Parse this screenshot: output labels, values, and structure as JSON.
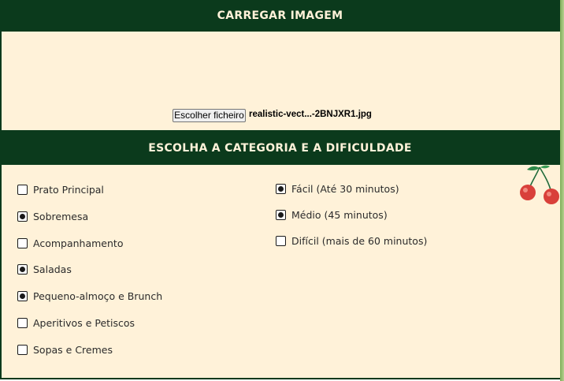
{
  "upload": {
    "title": "CARREGAR IMAGEM",
    "choose_label": "Escolher ficheiro",
    "file_name": "realistic-vect...-2BNJXR1.jpg"
  },
  "choose": {
    "title": "ESCOLHA A CATEGORIA E A DIFICULDADE"
  },
  "categories": [
    {
      "label": "Prato Principal",
      "checked": false
    },
    {
      "label": "Sobremesa",
      "checked": true
    },
    {
      "label": "Acompanhamento",
      "checked": false
    },
    {
      "label": "Saladas",
      "checked": true
    },
    {
      "label": "Pequeno-almoço e Brunch",
      "checked": true
    },
    {
      "label": "Aperitivos e Petiscos",
      "checked": false
    },
    {
      "label": "Sopas e Cremes",
      "checked": false
    }
  ],
  "difficulties": [
    {
      "label": "Fácil (Até 30 minutos)",
      "checked": true
    },
    {
      "label": "Médio (45 minutos)",
      "checked": true
    },
    {
      "label": "Difícil (mais de 60 minutos)",
      "checked": false
    }
  ],
  "colors": {
    "header_bg": "#0b3a1c",
    "panel_bg": "#fff2d9",
    "cherry_red": "#d9403a",
    "leaf_green": "#2f8a4a"
  },
  "decoration": {
    "icon": "cherries-icon"
  }
}
